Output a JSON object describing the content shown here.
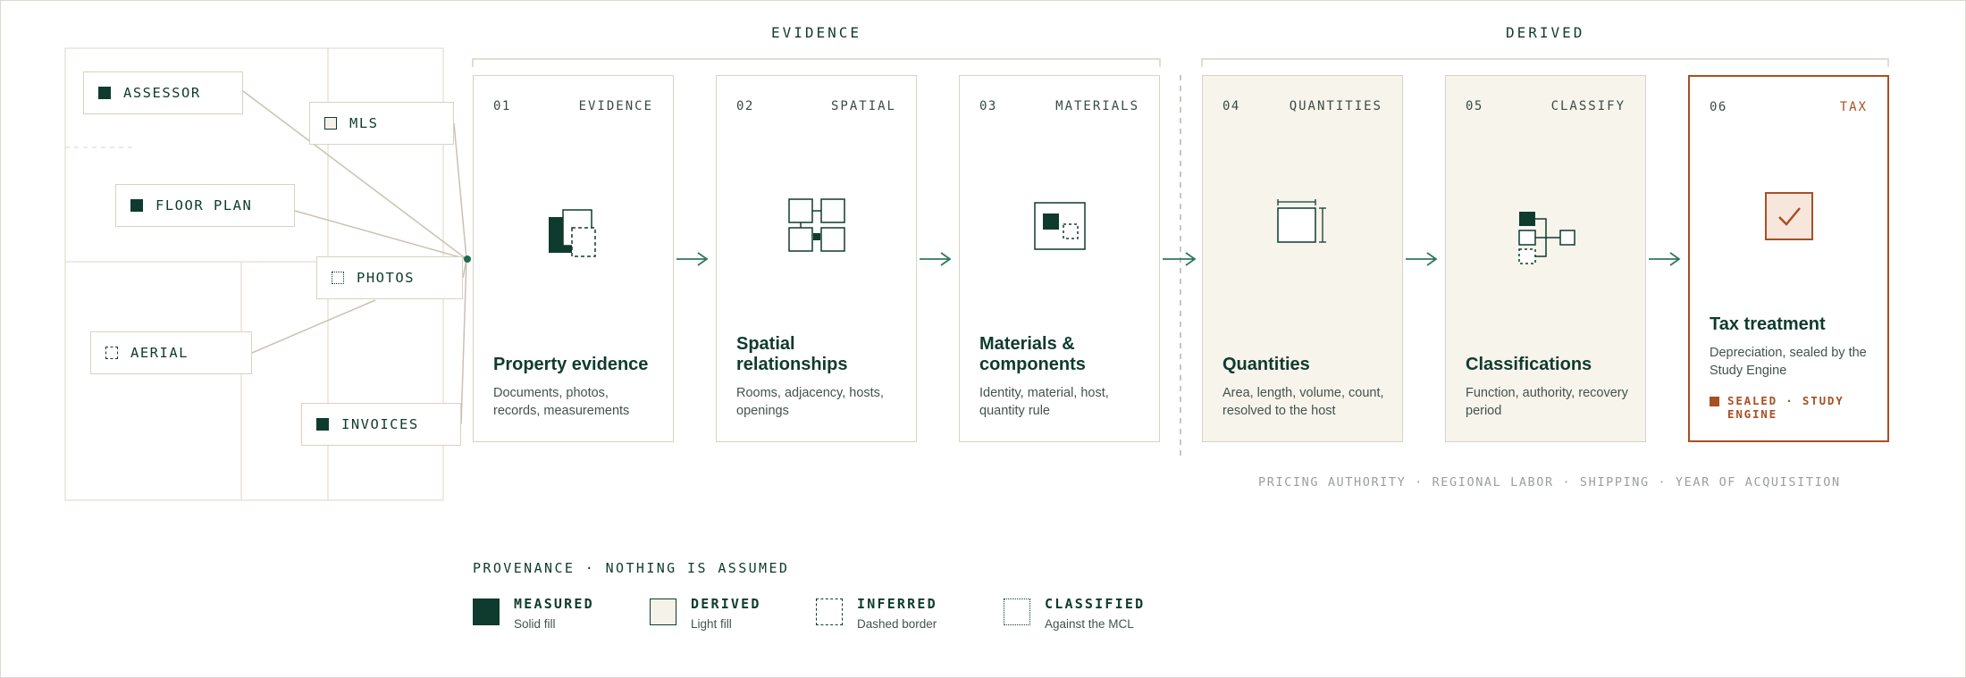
{
  "phases": {
    "evidence": "EVIDENCE",
    "derived": "DERIVED"
  },
  "sources": [
    {
      "label": "ASSESSOR",
      "kind": "measured"
    },
    {
      "label": "MLS",
      "kind": "derived"
    },
    {
      "label": "FLOOR PLAN",
      "kind": "measured"
    },
    {
      "label": "PHOTOS",
      "kind": "classified"
    },
    {
      "label": "AERIAL",
      "kind": "inferred"
    },
    {
      "label": "INVOICES",
      "kind": "measured"
    }
  ],
  "stages": [
    {
      "num": "01",
      "tag": "EVIDENCE",
      "title": "Property evidence",
      "desc": "Documents, photos, records, measurements",
      "icon": "stacked-documents-icon"
    },
    {
      "num": "02",
      "tag": "SPATIAL",
      "title": "Spatial relationships",
      "desc": "Rooms, adjacency, hosts, openings",
      "icon": "room-grid-icon"
    },
    {
      "num": "03",
      "tag": "MATERIALS",
      "title": "Materials & components",
      "desc": "Identity, material, host, quantity rule",
      "icon": "component-box-icon"
    },
    {
      "num": "04",
      "tag": "QUANTITIES",
      "title": "Quantities",
      "desc": "Area, length, volume, count, resolved to the host",
      "icon": "dimension-box-icon"
    },
    {
      "num": "05",
      "tag": "CLASSIFY",
      "title": "Classifications",
      "desc": "Function, authority, recovery period",
      "icon": "classification-tree-icon"
    },
    {
      "num": "06",
      "tag": "TAX",
      "title": "Tax treatment",
      "desc": "Depreciation, sealed by the Study Engine",
      "icon": "checkmark-box-icon",
      "seal": "SEALED · STUDY ENGINE"
    }
  ],
  "derived_note": "PRICING AUTHORITY · REGIONAL LABOR · SHIPPING · YEAR OF ACQUISITION",
  "provenance": {
    "title": "PROVENANCE · NOTHING IS ASSUMED",
    "items": [
      {
        "name": "MEASURED",
        "desc": "Solid fill",
        "kind": "measured"
      },
      {
        "name": "DERIVED",
        "desc": "Light fill",
        "kind": "derived"
      },
      {
        "name": "INFERRED",
        "desc": "Dashed border",
        "kind": "inferred"
      },
      {
        "name": "CLASSIFIED",
        "desc": "Against the MCL",
        "kind": "classified"
      }
    ]
  },
  "colors": {
    "ink": "#0f3b2e",
    "accent": "#a84f23",
    "beige_border": "#d8d2c4",
    "derived_fill": "#f7f4ec",
    "arrow": "#2f7a5a"
  }
}
